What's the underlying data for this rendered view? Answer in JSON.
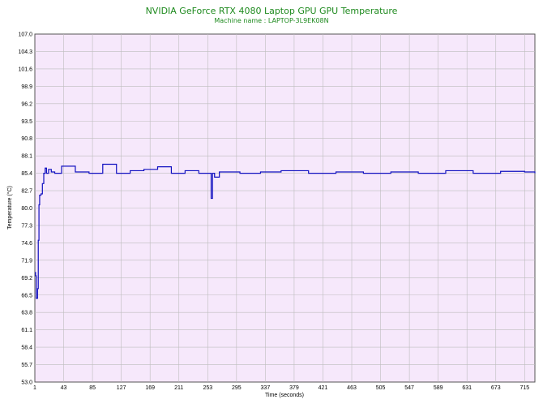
{
  "chart_data": {
    "type": "line",
    "title": "NVIDIA GeForce RTX 4080 Laptop GPU GPU Temperature",
    "subtitle": "Machine name : LAPTOP-3L9EK08N",
    "xlabel": "Time (seconds)",
    "ylabel": "Temperature (°C)",
    "xlim": [
      1,
      730
    ],
    "ylim": [
      53.0,
      107.0
    ],
    "x_ticks": [
      "1",
      "43",
      "85",
      "127",
      "169",
      "211",
      "253",
      "295",
      "337",
      "379",
      "421",
      "463",
      "505",
      "547",
      "589",
      "631",
      "673",
      "715"
    ],
    "y_ticks": [
      "107.0",
      "104.3",
      "101.6",
      "98.9",
      "96.2",
      "93.5",
      "90.8",
      "88.1",
      "85.4",
      "82.7",
      "80.0",
      "77.3",
      "74.6",
      "71.9",
      "69.2",
      "66.5",
      "63.8",
      "61.1",
      "58.4",
      "55.7",
      "53.0"
    ],
    "grid": true,
    "colors": {
      "plot_background": "#f6e8fb",
      "grid": "#bdbdbd",
      "line": "#1010c0",
      "title": "#1e8a1e"
    },
    "series": [
      {
        "name": "",
        "x": [
          1,
          2,
          3,
          4,
          5,
          6,
          7,
          8,
          10,
          12,
          14,
          16,
          18,
          21,
          25,
          30,
          40,
          60,
          80,
          100,
          120,
          140,
          160,
          180,
          200,
          220,
          240,
          255,
          258,
          260,
          263,
          270,
          300,
          330,
          360,
          400,
          440,
          480,
          520,
          560,
          600,
          640,
          680,
          715,
          730
        ],
        "y": [
          70.0,
          69.5,
          66.0,
          66.0,
          67.5,
          75.0,
          80.5,
          82.0,
          82.2,
          83.8,
          85.4,
          86.2,
          85.4,
          86.0,
          85.6,
          85.4,
          86.5,
          85.6,
          85.4,
          86.8,
          85.4,
          85.8,
          86.0,
          86.4,
          85.4,
          85.8,
          85.4,
          85.4,
          81.5,
          85.4,
          84.8,
          85.6,
          85.4,
          85.6,
          85.8,
          85.4,
          85.6,
          85.4,
          85.6,
          85.4,
          85.8,
          85.4,
          85.7,
          85.6,
          85.4
        ]
      }
    ]
  }
}
